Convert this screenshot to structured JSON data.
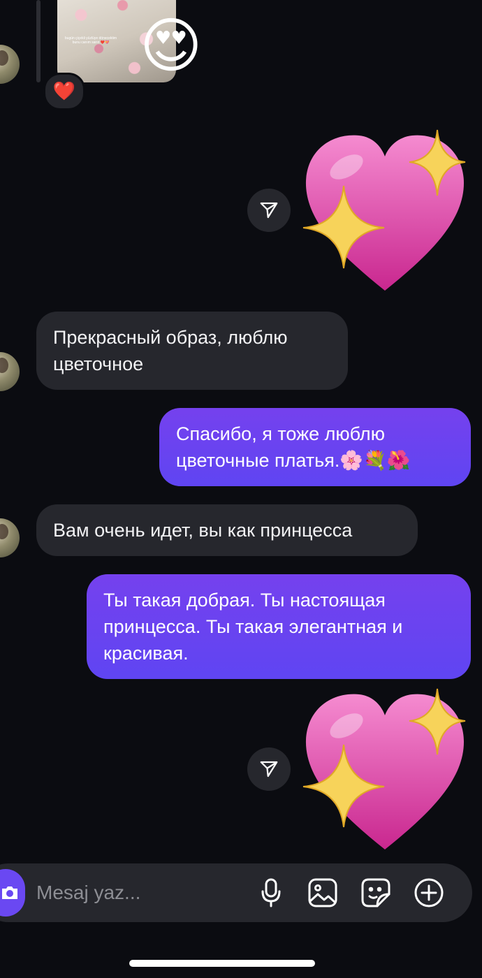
{
  "thread": {
    "shared_post": {
      "caption": "bugün çiçekli yüzlüye dönecektim bunu canım sarın ❤️💝",
      "overlay_emoji": "😍",
      "reaction_emoji": "❤️"
    },
    "messages": [
      {
        "direction": "incoming",
        "text": "Прекрасный образ, люблю цветочное"
      },
      {
        "direction": "outgoing",
        "text": "Спасибо, я тоже люблю цветочные платья.🌸💐🌺"
      },
      {
        "direction": "incoming",
        "text": "Вам очень идет, вы как принцесса"
      },
      {
        "direction": "outgoing",
        "text": "Ты такая добрая. Ты настоящая принцесса. Ты такая элегантная и красивая."
      }
    ],
    "stickers": [
      {
        "emoji": "💖"
      },
      {
        "emoji": "💖"
      }
    ]
  },
  "composer": {
    "placeholder": "Mesaj yaz...",
    "icons": [
      "camera-icon",
      "microphone-icon",
      "gallery-icon",
      "sticker-icon",
      "plus-icon"
    ]
  },
  "colors": {
    "background": "#0b0c11",
    "incoming_bubble": "#26272d",
    "outgoing_bubble": "#6a3ff0",
    "accent": "#6a48f2"
  }
}
